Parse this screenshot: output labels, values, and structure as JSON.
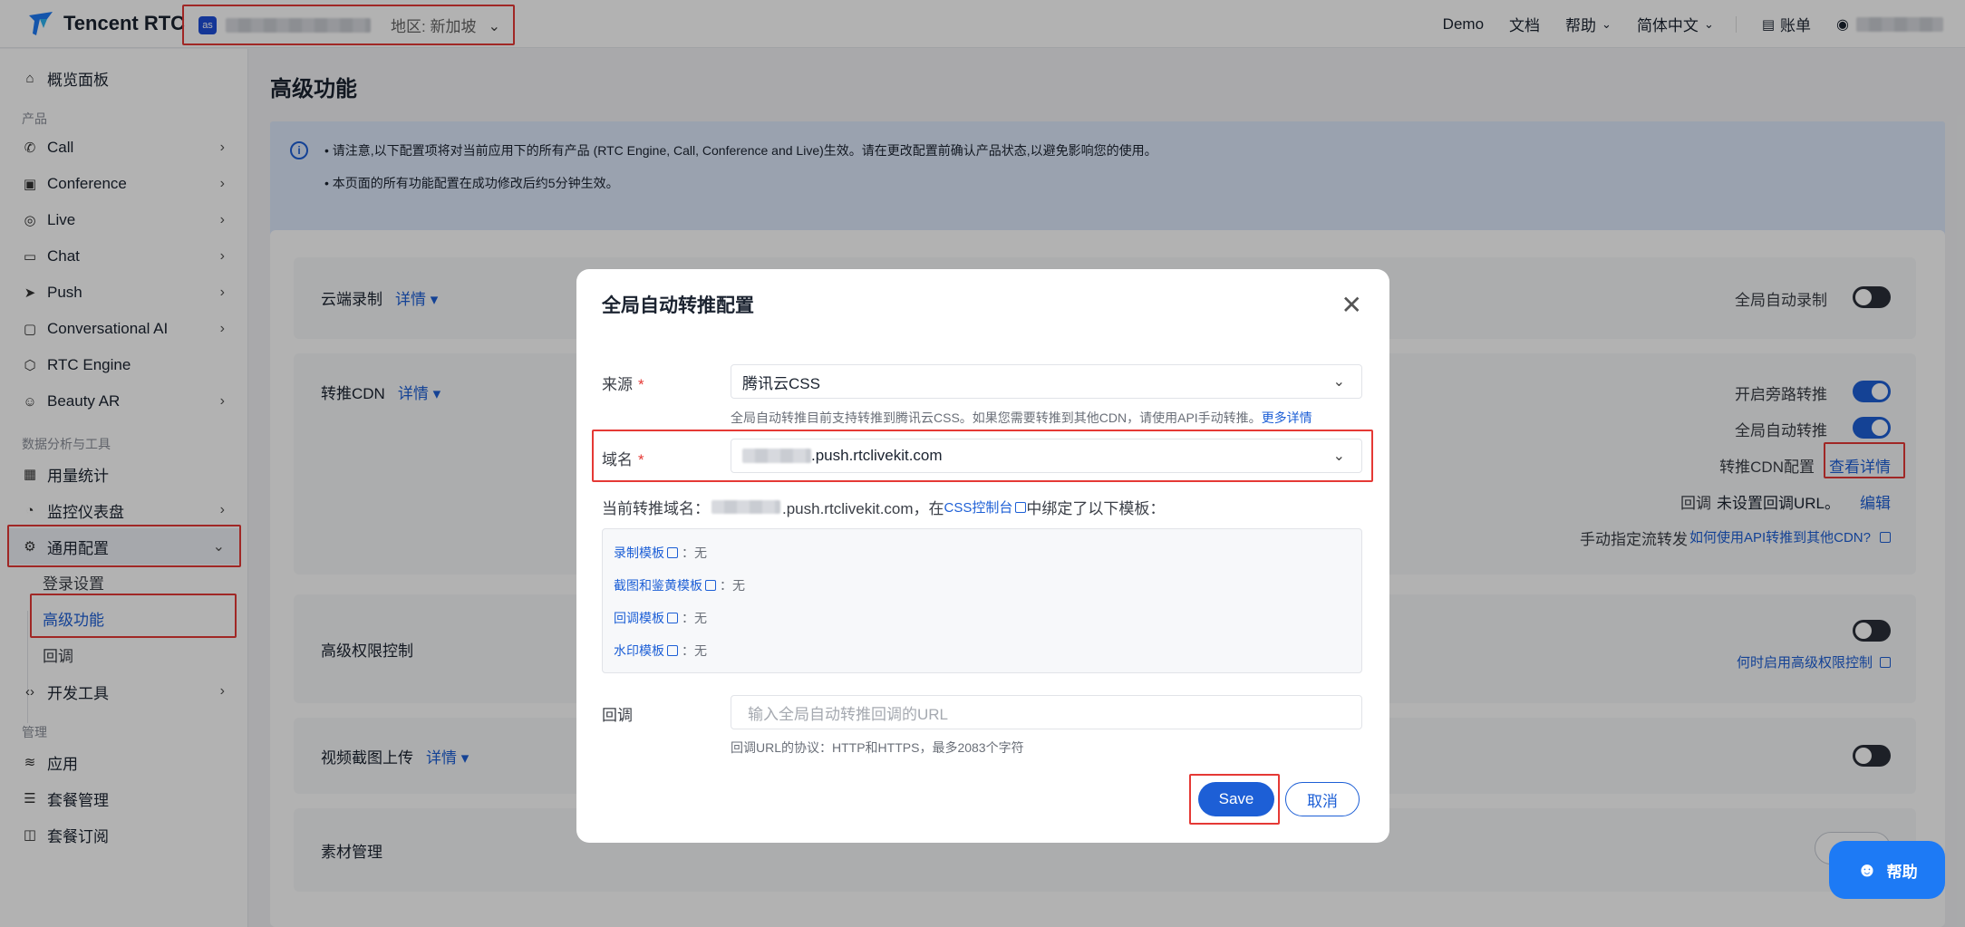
{
  "header": {
    "brand": "Tencent RTC",
    "app_badge": "as",
    "app_region": "地区: 新加坡",
    "nav": {
      "demo": "Demo",
      "docs": "文档",
      "help": "帮助",
      "lang": "简体中文",
      "billing": "账单"
    }
  },
  "sidebar": {
    "overview": "概览面板",
    "products_section": "产品",
    "products": [
      "Call",
      "Conference",
      "Live",
      "Chat",
      "Push",
      "Conversational AI",
      "RTC Engine",
      "Beauty AR"
    ],
    "tools_section": "数据分析与工具",
    "usage": "用量统计",
    "monitor": "监控仪表盘",
    "general_config": "通用配置",
    "sub_items": [
      "登录设置",
      "高级功能",
      "回调"
    ],
    "devtools": "开发工具",
    "manage_section": "管理",
    "manage": [
      "应用",
      "套餐管理",
      "套餐订阅"
    ]
  },
  "main": {
    "title": "高级功能",
    "notice_line1": "请注意,以下配置项将对当前应用下的所有产品 (RTC Engine, Call, Conference and Live)生效。请在更改配置前确认产品状态,以避免影响您的使用。",
    "notice_line2": "本页面的所有功能配置在成功修改后约5分钟生效。",
    "cards": {
      "cloud_record": {
        "title": "云端录制",
        "detail": "详情 ▾",
        "toggle_label": "全局自动录制",
        "toggle_on": false
      },
      "cdn": {
        "title": "转推CDN",
        "detail": "详情 ▾",
        "bypass_label": "开启旁路转推",
        "bypass_on": true,
        "auto_label": "全局自动转推",
        "auto_on": true,
        "config_label": "转推CDN配置",
        "config_link": "查看详情",
        "callback_label": "回调",
        "callback_value": "未设置回调URL。",
        "callback_edit": "编辑",
        "manual_label": "手动指定流转发",
        "manual_link": "如何使用API转推到其他CDN?"
      },
      "permission": {
        "title": "高级权限控制",
        "toggle_on": false,
        "link": "何时启用高级权限控制"
      },
      "snapshot": {
        "title": "视频截图上传",
        "detail": "详情 ▾",
        "toggle_on": false
      },
      "material": {
        "title": "素材管理"
      }
    }
  },
  "modal": {
    "title": "全局自动转推配置",
    "source_label": "来源",
    "source_value": "腾讯云CSS",
    "source_hint": "全局自动转推目前支持转推到腾讯云CSS。如果您需要转推到其他CDN，请使用API手动转推。",
    "source_hint_link": "更多详情",
    "domain_label": "域名",
    "domain_value": ".push.rtclivekit.com",
    "current_prefix": "当前转推域名：",
    "current_domain": ".push.rtclivekit.com，在",
    "css_console": "CSS控制台",
    "current_suffix": "中绑定了以下模板：",
    "templates": [
      {
        "name": "录制模板",
        "value": "：无"
      },
      {
        "name": "截图和鉴黄模板",
        "value": "：无"
      },
      {
        "name": "回调模板",
        "value": "：无"
      },
      {
        "name": "水印模板",
        "value": "：无"
      }
    ],
    "callback_label": "回调",
    "callback_placeholder": "输入全局自动转推回调的URL",
    "callback_hint": "回调URL的协议：HTTP和HTTPS，最多2083个字符",
    "save": "Save",
    "cancel": "取消"
  },
  "help_fab": "帮助"
}
